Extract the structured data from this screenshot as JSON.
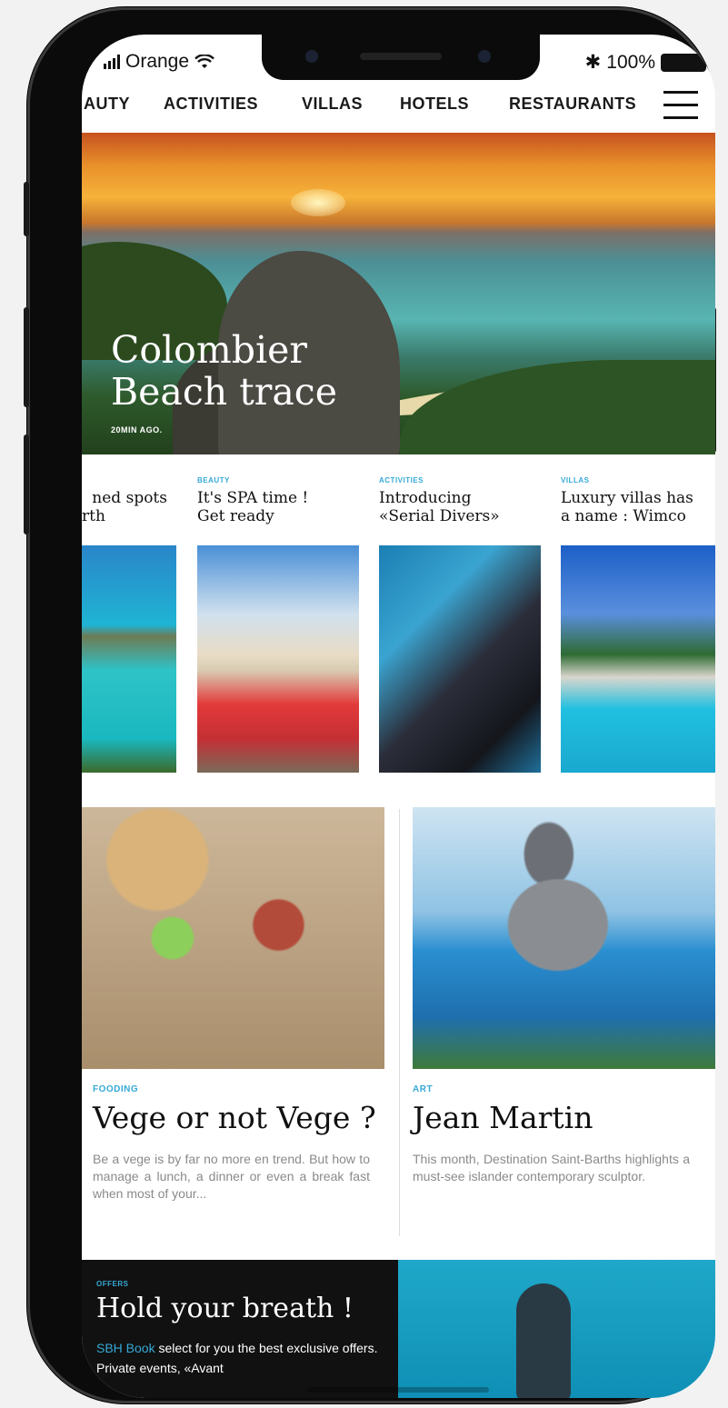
{
  "status_bar": {
    "carrier": "Orange",
    "battery": "100%",
    "bluetooth_glyph": "✱"
  },
  "nav": {
    "items": [
      "AUTY",
      "ACTIVITIES",
      "VILLAS",
      "HOTELS",
      "RESTAURANTS"
    ],
    "menu_icon": "hamburger-menu-icon"
  },
  "hero": {
    "title_line1": "Colombier",
    "title_line2": "Beach trace",
    "time": "20MIN AGO."
  },
  "cards": [
    {
      "category": "",
      "title_line1": "ned spots",
      "title_line2": "rth"
    },
    {
      "category": "BEAUTY",
      "title_line1": "It's SPA time !",
      "title_line2": "Get ready"
    },
    {
      "category": "ACTIVITIES",
      "title_line1": "Introducing",
      "title_line2": "«Serial Divers»"
    },
    {
      "category": "VILLAS",
      "title_line1": "Luxury villas has",
      "title_line2": "a name : Wimco"
    }
  ],
  "articles": [
    {
      "category": "FOODING",
      "title": "Vege or not Vege ?",
      "description": "Be a vege is by far no more en trend. But how to manage a lunch, a dinner or even a break fast when most of your..."
    },
    {
      "category": "ART",
      "title": "Jean Martin",
      "description": "This month, Destination Saint-Barths highlights a must-see islander contemporary sculptor."
    }
  ],
  "offers": {
    "category": "OFFERS",
    "title": "Hold your breath !",
    "highlight": "SBH Book",
    "description_rest": " select for you the best exclusive offers. Private events, «Avant"
  },
  "colors": {
    "accent": "#36a9d6",
    "text": "#111111",
    "muted_text": "#8a8a8a",
    "offers_bg": "#111111"
  }
}
